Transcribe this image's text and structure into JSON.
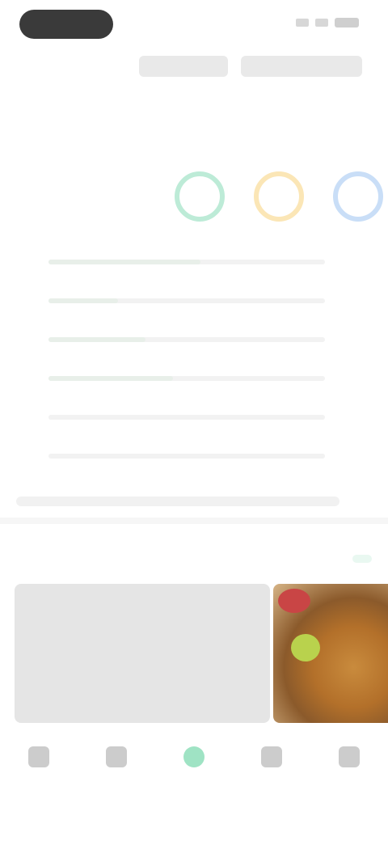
{
  "status": {
    "time": ""
  },
  "summary": {
    "title": "",
    "link": "",
    "calories": "",
    "calorie_unit": ""
  },
  "nutrients": [
    {
      "name": "",
      "value": "",
      "fill": 0.55
    },
    {
      "name": "",
      "value": "",
      "fill": 0.25
    },
    {
      "name": "",
      "value": "",
      "fill": 0.35
    },
    {
      "name": "",
      "value": "",
      "fill": 0.45
    },
    {
      "name": "",
      "value": "",
      "fill": 0.0
    },
    {
      "name": "",
      "value": "",
      "fill": 0.0
    }
  ],
  "recipes": {
    "title": "",
    "more": ""
  },
  "tabs": [
    {
      "label": "",
      "icon": "home-icon"
    },
    {
      "label": "",
      "icon": "chart-icon"
    },
    {
      "label": "",
      "icon": "add-icon"
    },
    {
      "label": "",
      "icon": "book-icon"
    },
    {
      "label": "",
      "icon": "profile-icon"
    }
  ],
  "colors": {
    "accent": "#6fd2a4",
    "circle_green": "#bdebd7",
    "circle_yellow": "#fbe6b6",
    "circle_blue": "#c9def7"
  }
}
